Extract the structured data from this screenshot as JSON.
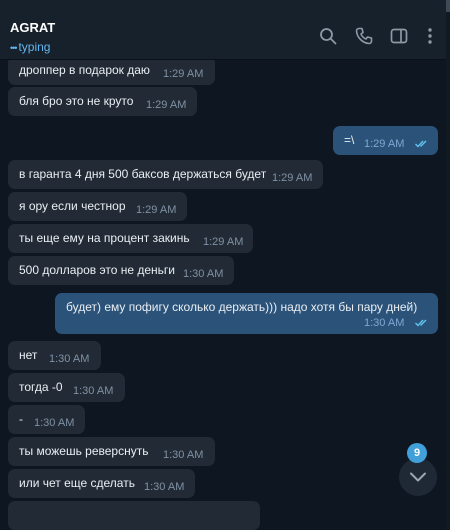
{
  "header": {
    "title": "AGRAT",
    "status_dots": "•••",
    "status": "typing",
    "icons": [
      "search-icon",
      "phone-icon",
      "sidebar-toggle-icon",
      "more-vertical-icon"
    ]
  },
  "messages": [
    {
      "side": "in",
      "text": "дроппер в подарок даю",
      "time": "1:29 AM"
    },
    {
      "side": "in",
      "text": "бля бро это не круто",
      "time": "1:29 AM"
    },
    {
      "side": "out",
      "text": "=\\",
      "time": "1:29 AM",
      "read": true
    },
    {
      "side": "in",
      "text": "в гаранта 4 дня 500 баксов держаться будет",
      "time": "1:29 AM"
    },
    {
      "side": "in",
      "text": "я ору если честнор",
      "time": "1:29 AM"
    },
    {
      "side": "in",
      "text": "ты еще ему на процент закинь",
      "time": "1:29 AM"
    },
    {
      "side": "in",
      "text": "500 долларов это не деньги",
      "time": "1:30 AM"
    },
    {
      "side": "out",
      "text": "будет) ему пофигу сколько держать))) надо хотя бы пару дней)",
      "time": "1:30 AM",
      "read": true
    },
    {
      "side": "in",
      "text": "нет",
      "time": "1:30 AM"
    },
    {
      "side": "in",
      "text": "тогда -0",
      "time": "1:30 AM"
    },
    {
      "side": "in",
      "text": "-",
      "time": "1:30 AM"
    },
    {
      "side": "in",
      "text": "ты можешь реверснуть",
      "time": "1:30 AM"
    },
    {
      "side": "in",
      "text": "или чет еще сделать",
      "time": "1:30 AM"
    }
  ],
  "scroll_down": {
    "unread_count": "9"
  },
  "colors": {
    "background": "#0e1621",
    "incoming": "#222b35",
    "outgoing": "#2b5278",
    "accent": "#419fd9"
  }
}
